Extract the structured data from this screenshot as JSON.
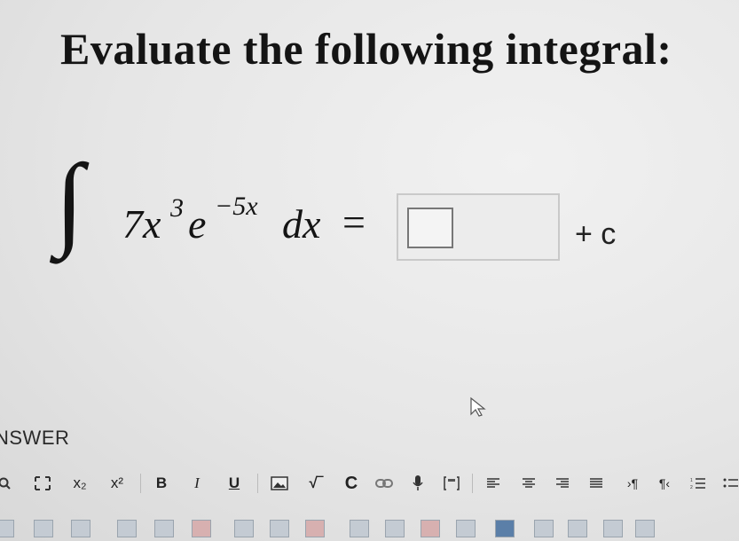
{
  "question": {
    "title": "Evaluate the following integral:",
    "integral_sign": "∫",
    "coefficient": "7x",
    "power": "3",
    "base": "e",
    "exponent": "−5x",
    "differential": "dx",
    "equals": "=",
    "constant": "+ c"
  },
  "answer": {
    "label": "NSWER",
    "input_value": ""
  },
  "toolbar": {
    "subscript": "x₂",
    "superscript": "x²",
    "bold": "B",
    "italic": "I",
    "underline": "U",
    "sqrt": "√‾",
    "special": "C",
    "paragraph_ltr": "›¶",
    "paragraph_rtl": "¶‹"
  }
}
